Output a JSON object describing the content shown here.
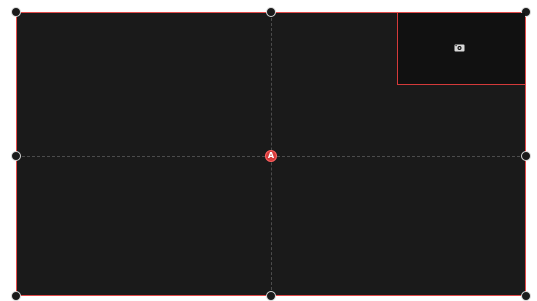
{
  "canvas": {
    "frame_color": "#e24b4b",
    "background_color": "#1a1a1a",
    "guide_color": "#4b4b4b"
  },
  "anchor": {
    "label": "A",
    "color": "#d43a3a"
  },
  "preview": {
    "icon": "camera-icon"
  }
}
